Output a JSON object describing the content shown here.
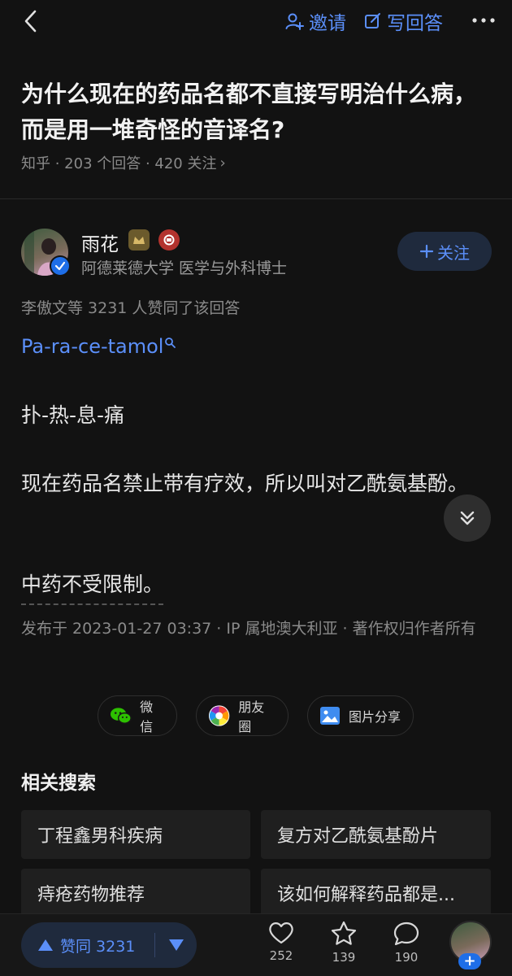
{
  "header": {
    "invite_label": "邀请",
    "write_label": "写回答"
  },
  "question": {
    "title": "为什么现在的药品名都不直接写明治什么病，而是用一堆奇怪的音译名?",
    "meta": "知乎 · 203 个回答 · 420 关注",
    "meta_chevron": "›"
  },
  "author": {
    "name": "雨花",
    "description": "阿德莱德大学 医学与外科博士",
    "follow_label": "关注"
  },
  "answer": {
    "upvoters": "李傲文等 3231 人赞同了该回答",
    "link_text": "Pa-ra-ce-tamol",
    "p2": "扑-热-息-痛",
    "p3": "现在药品名禁止带有疗效，所以叫对乙酰氨基酚。",
    "p4": "中药不受限制。",
    "publish_info": "发布于 2023-01-27 03:37 · IP 属地澳大利亚 · 著作权归作者所有"
  },
  "share": {
    "wechat": "微信",
    "moments": "朋友圈",
    "image": "图片分享"
  },
  "related": {
    "title": "相关搜索",
    "items": [
      "丁程鑫男科疾病",
      "复方对乙酰氨基酚片",
      "痔疮药物推荐",
      "该如何解释药品都是..."
    ]
  },
  "bottom": {
    "vote_label": "赞同 3231",
    "likes": "252",
    "favorites": "139",
    "comments": "190"
  },
  "colors": {
    "accent": "#5b8ff9",
    "background": "#121212"
  }
}
